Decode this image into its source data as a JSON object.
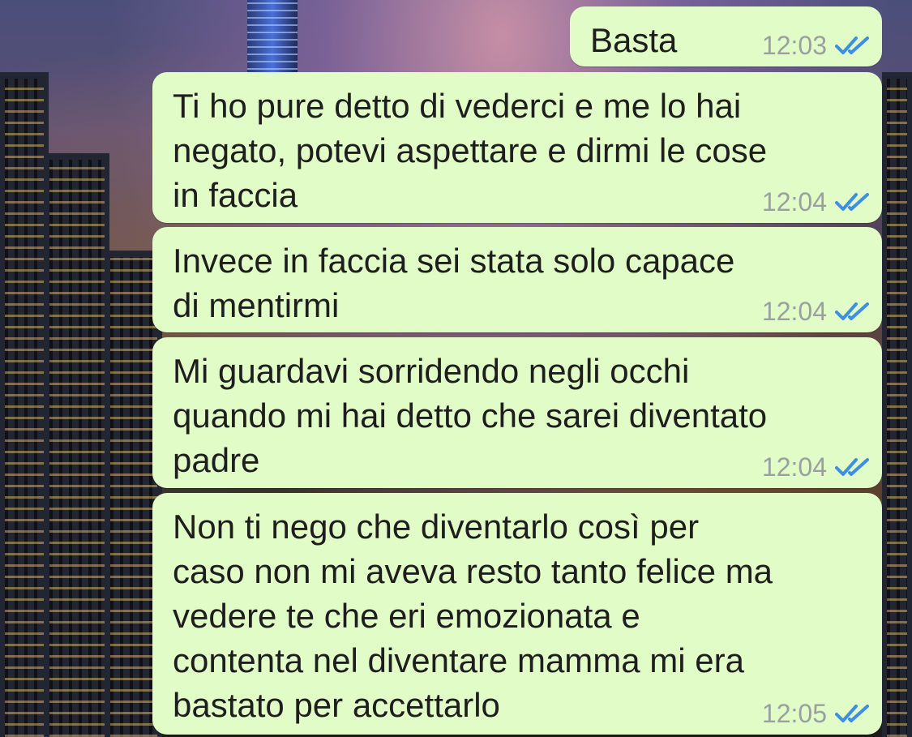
{
  "messages": [
    {
      "text": "Basta",
      "time": "12:03",
      "status": "read"
    },
    {
      "text": "Ti ho pure detto di vederci e me lo hai\nnegato, potevi aspettare e dirmi le cose\nin faccia",
      "time": "12:04",
      "status": "read"
    },
    {
      "text": "Invece in faccia sei stata solo capace\ndi mentirmi",
      "time": "12:04",
      "status": "read"
    },
    {
      "text": "Mi guardavi sorridendo negli occhi\nquando mi hai detto che sarei diventato\npadre",
      "time": "12:04",
      "status": "read"
    },
    {
      "text": "Non ti nego che diventarlo così per\ncaso non mi aveva resto tanto felice ma\nvedere te che eri emozionata e\ncontenta nel diventare mamma mi era\nbastato per accettarlo",
      "time": "12:05",
      "status": "read"
    }
  ],
  "colors": {
    "outgoing_bubble": "#e1fcc7",
    "read_ticks": "#3d8ee6",
    "timestamp": "#9aa0a0"
  },
  "icons": {
    "read_status": "double-check-icon"
  }
}
